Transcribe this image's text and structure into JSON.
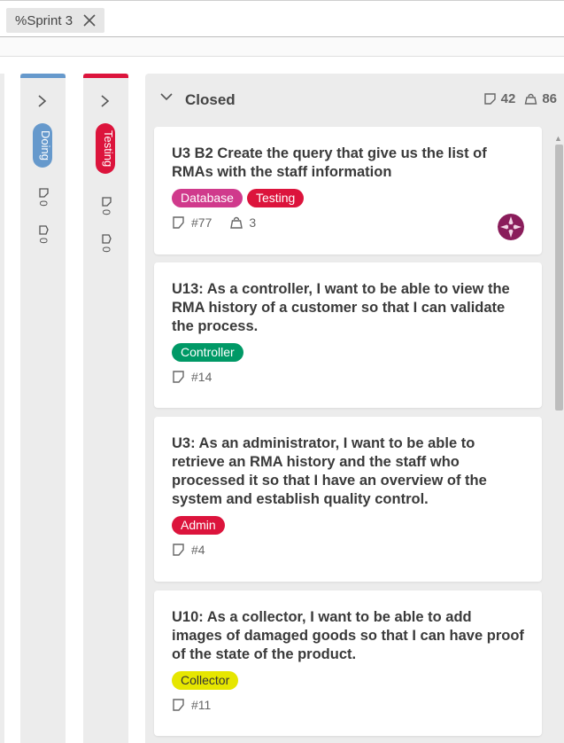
{
  "filter": {
    "chip_label": "%Sprint 3",
    "close_icon": "close-icon"
  },
  "columns_collapsed": [
    {
      "label": "Doing",
      "color": "#6699cc",
      "count_a": "0",
      "count_b": "0"
    },
    {
      "label": "Testing",
      "color": "#dc143c",
      "count_a": "0",
      "count_b": "0"
    }
  ],
  "closed": {
    "title": "Closed",
    "points_total": "42",
    "weight_total": "86",
    "cards": [
      {
        "title": "U3 B2 Create the query that give us the list of RMAs with the staff information",
        "tags": [
          {
            "label": "Database",
            "color": "#d03a8c"
          },
          {
            "label": "Testing",
            "color": "#dc143c"
          }
        ],
        "number": "#77",
        "weight": "3",
        "has_avatar": true
      },
      {
        "title": "U13: As a controller, I want to be able to view the RMA history of a customer so that I can validate the process.",
        "tags": [
          {
            "label": "Controller",
            "color": "#009966"
          }
        ],
        "number": "#14"
      },
      {
        "title": "U3: As an administrator, I want to be able to retrieve an RMA history and the staff who processed it so that I have an overview of the system and establish quality control.",
        "tags": [
          {
            "label": "Admin",
            "color": "#dc143c"
          }
        ],
        "number": "#4"
      },
      {
        "title": "U10: As a collector, I want to be able to add images of damaged goods so that I can have proof of the state of the product.",
        "tags": [
          {
            "label": "Collector",
            "color": "#e6e600"
          }
        ],
        "number": "#11"
      }
    ]
  }
}
